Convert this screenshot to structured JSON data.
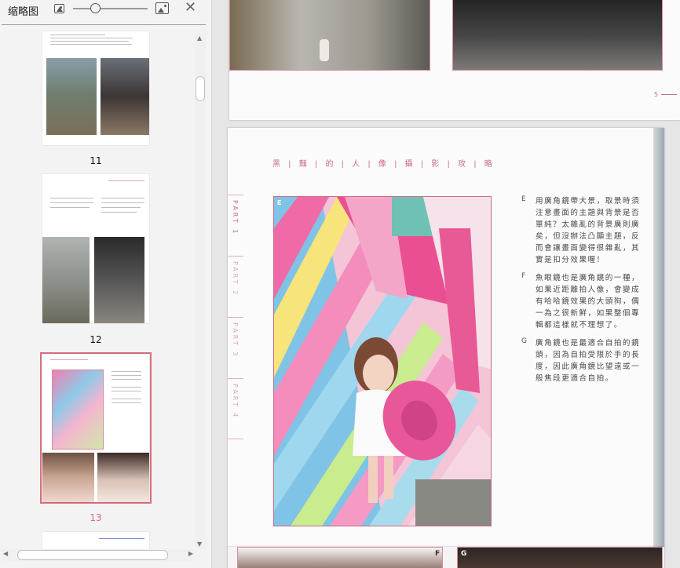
{
  "panel": {
    "title": "缩略图",
    "icons": {
      "zoom_out": "image-small-icon",
      "zoom_in": "image-large-icon",
      "close": "close-icon"
    },
    "close_glyph": "✕",
    "zoom_level": 0.3
  },
  "thumbnails": [
    {
      "label": "11"
    },
    {
      "label": "12"
    },
    {
      "label": "13",
      "selected": true
    }
  ],
  "running_head": "黑 | 麵 | 的 | 人 | 像 | 攝 | 影 | 攻 | 略",
  "parts": [
    "PART 1",
    "PART 2",
    "PART 3",
    "PART 4"
  ],
  "photo_label": "E",
  "notes": [
    {
      "letter": "E",
      "text": "用廣角鏡帶大景，取景時須注意畫面的主題與背景是否單純？太雜亂的背景廣則廣矣，但沒辦法凸顯主題，反而會讓畫面變得很雜亂，其實是扣分效果喔！"
    },
    {
      "letter": "F",
      "text": "魚眼鏡也是廣角鏡的一種，如果近距離拍人像，會變成有哈哈鏡效果的大頭狗，偶一為之很新鮮，如果整個專輯都這樣就不理想了。"
    },
    {
      "letter": "G",
      "text": "廣角鏡也是最適合自拍的鏡頭，因為自拍受限於手的長度，因此廣角鏡比望遠或一般焦段更適合自拍。"
    }
  ],
  "page_number": "5",
  "next_page_labels": {
    "f": "F",
    "g": "G"
  },
  "colors": {
    "accent": "#c86e86",
    "selected_frame": "#d9707e"
  }
}
